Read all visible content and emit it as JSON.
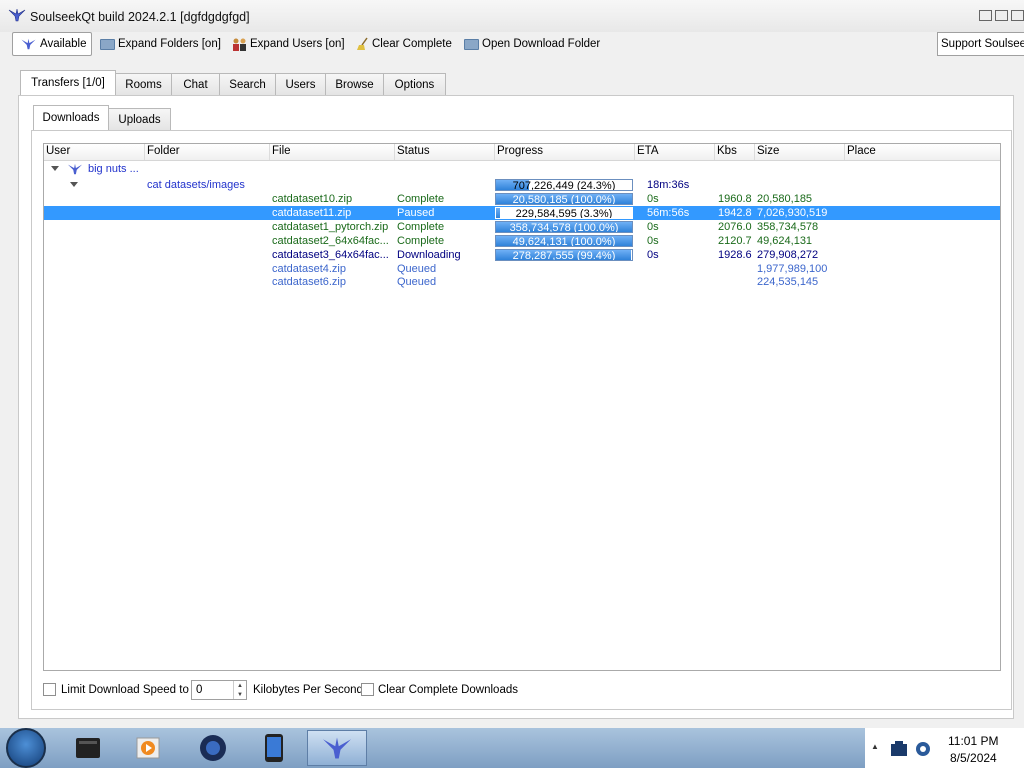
{
  "window": {
    "title": "SoulseekQt build 2024.2.1 [dgfdgdgfgd]"
  },
  "toolbar": {
    "available": "Available",
    "expand_folders": "Expand Folders [on]",
    "expand_users": "Expand Users [on]",
    "clear_complete": "Clear Complete",
    "open_download_folder": "Open Download Folder",
    "support": "Support Soulseek"
  },
  "main_tabs": [
    "Transfers [1/0]",
    "Rooms",
    "Chat",
    "Search",
    "Users",
    "Browse",
    "Options"
  ],
  "sub_tabs": [
    "Downloads",
    "Uploads"
  ],
  "columns": [
    "User",
    "Folder",
    "File",
    "Status",
    "Progress",
    "ETA",
    "Kbs",
    "Size",
    "Place"
  ],
  "tree": {
    "user": "big nuts ...",
    "folder": "cat datasets/images",
    "folder_progress": {
      "text": "707,226,449 (24.3%)",
      "fraction": 0.243
    },
    "folder_eta": "18m:36s",
    "files": [
      {
        "file": "catdataset10.zip",
        "status": "Complete",
        "progress": "20,580,185 (100.0%)",
        "fraction": 1.0,
        "eta": "0s",
        "kbs": "1960.8",
        "size": "20,580,185",
        "color": "green"
      },
      {
        "file": "catdataset11.zip",
        "status": "Paused",
        "progress": "229,584,595 (3.3%)",
        "fraction": 0.033,
        "eta": "56m:56s",
        "kbs": "1942.8",
        "size": "7,026,930,519",
        "color": "selected"
      },
      {
        "file": "catdataset1_pytorch.zip",
        "status": "Complete",
        "progress": "358,734,578 (100.0%)",
        "fraction": 1.0,
        "eta": "0s",
        "kbs": "2076.0",
        "size": "358,734,578",
        "color": "green"
      },
      {
        "file": "catdataset2_64x64fac...",
        "status": "Complete",
        "progress": "49,624,131 (100.0%)",
        "fraction": 1.0,
        "eta": "0s",
        "kbs": "2120.7",
        "size": "49,624,131",
        "color": "green"
      },
      {
        "file": "catdataset3_64x64fac...",
        "status": "Downloading",
        "progress": "278,287,555 (99.4%)",
        "fraction": 0.994,
        "eta": "0s",
        "kbs": "1928.6",
        "size": "279,908,272",
        "color": "dark"
      },
      {
        "file": "catdataset4.zip",
        "status": "Queued",
        "progress": "",
        "fraction": null,
        "eta": "",
        "kbs": "",
        "size": "1,977,989,100",
        "color": "queued"
      },
      {
        "file": "catdataset6.zip",
        "status": "Queued",
        "progress": "",
        "fraction": null,
        "eta": "",
        "kbs": "",
        "size": "224,535,145",
        "color": "queued"
      }
    ]
  },
  "bottom": {
    "limit_label": "Limit Download Speed to",
    "speed_value": "0",
    "unit_label": "Kilobytes Per Second",
    "clear_label": "Clear Complete Downloads"
  },
  "taskbar": {
    "time": "11:01 PM",
    "date": "8/5/2024"
  }
}
